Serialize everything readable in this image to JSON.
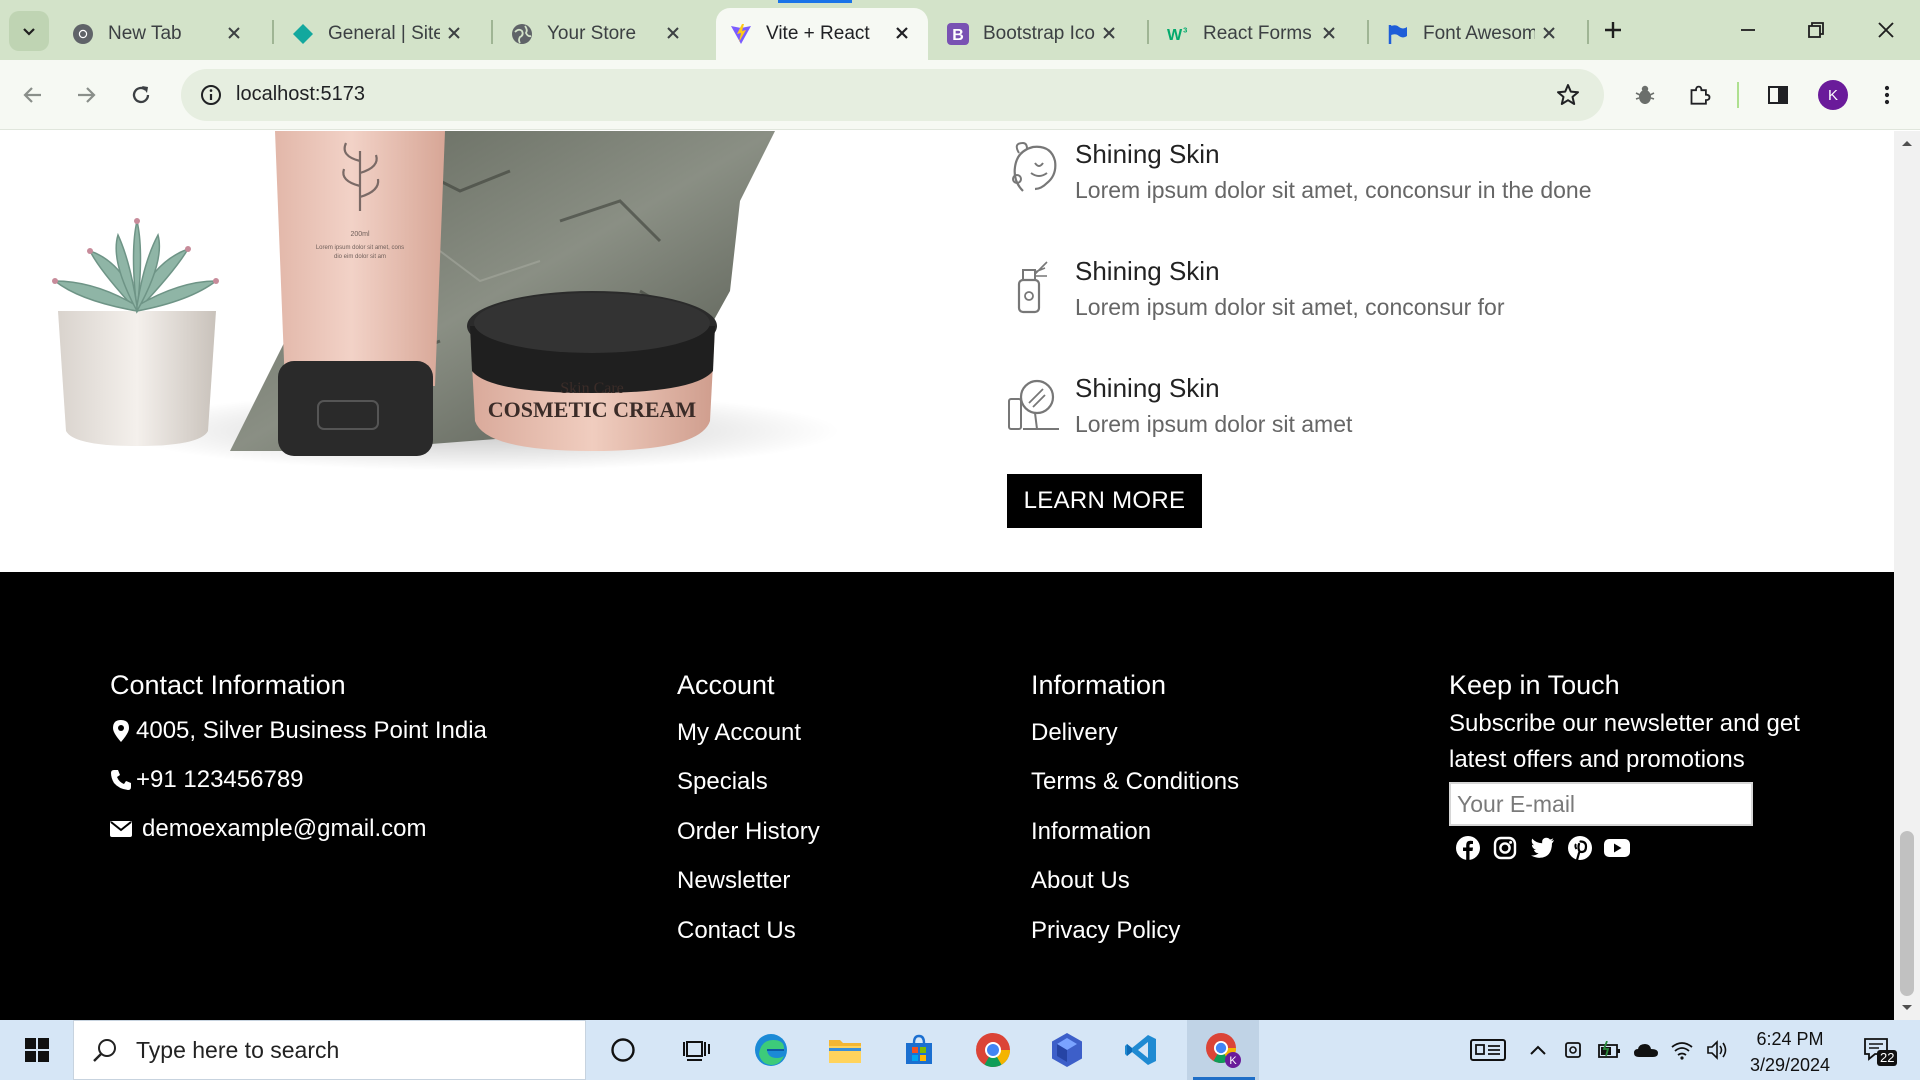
{
  "browser": {
    "tabs": [
      {
        "title": "New Tab",
        "favicon": "chrome-icon"
      },
      {
        "title": "General | Site",
        "favicon": "diamond-icon"
      },
      {
        "title": "Your Store",
        "favicon": "globe-icon"
      },
      {
        "title": "Vite + React",
        "favicon": "vite-icon",
        "active": true
      },
      {
        "title": "Bootstrap Icon",
        "favicon": "bootstrap-icon"
      },
      {
        "title": "React Forms",
        "favicon": "w3schools-icon"
      },
      {
        "title": "Font Awesom",
        "favicon": "flag-icon"
      }
    ],
    "url": "localhost:5173",
    "profile_initial": "K",
    "colors": {
      "tabstrip": "#d3e3c9",
      "toolbar": "#f6f9f3",
      "avatar": "#6a1b9a"
    }
  },
  "page": {
    "features": [
      {
        "title": "Shining Skin",
        "text": "Lorem ipsum dolor sit amet, conconsur in the done",
        "icon": "face-care-icon"
      },
      {
        "title": "Shining Skin",
        "text": "Lorem ipsum dolor sit amet, conconsur for",
        "icon": "spray-bottle-icon"
      },
      {
        "title": "Shining Skin",
        "text": "Lorem ipsum dolor sit amet",
        "icon": "mirror-cream-icon"
      }
    ],
    "learn_more": "LEARN MORE",
    "product_image": {
      "tube_text": "200ml Lorem ipsum dolor sit amet, cons dio eim dolor sit am",
      "jar_line1": "Skin Care",
      "jar_line2": "COSMETIC CREAM"
    }
  },
  "footer": {
    "contact": {
      "heading": "Contact Information",
      "address": "4005, Silver Business Point India",
      "phone": "+91 123456789",
      "email": "demoexample@gmail.com"
    },
    "account": {
      "heading": "Account",
      "links": [
        "My Account",
        "Specials",
        "Order History",
        "Newsletter",
        "Contact Us"
      ]
    },
    "information": {
      "heading": "Information",
      "links": [
        "Delivery",
        "Terms & Conditions",
        "Information",
        "About Us",
        "Privacy Policy"
      ]
    },
    "keep_in_touch": {
      "heading": "Keep in Touch",
      "text": "Subscribe our newsletter and get latest offers and promotions",
      "email_placeholder": "Your E-mail",
      "social": [
        "facebook-icon",
        "instagram-icon",
        "twitter-icon",
        "pinterest-icon",
        "youtube-icon"
      ]
    }
  },
  "taskbar": {
    "search_placeholder": "Type here to search",
    "time": "6:24 PM",
    "date": "3/29/2024",
    "notifications": "22"
  }
}
